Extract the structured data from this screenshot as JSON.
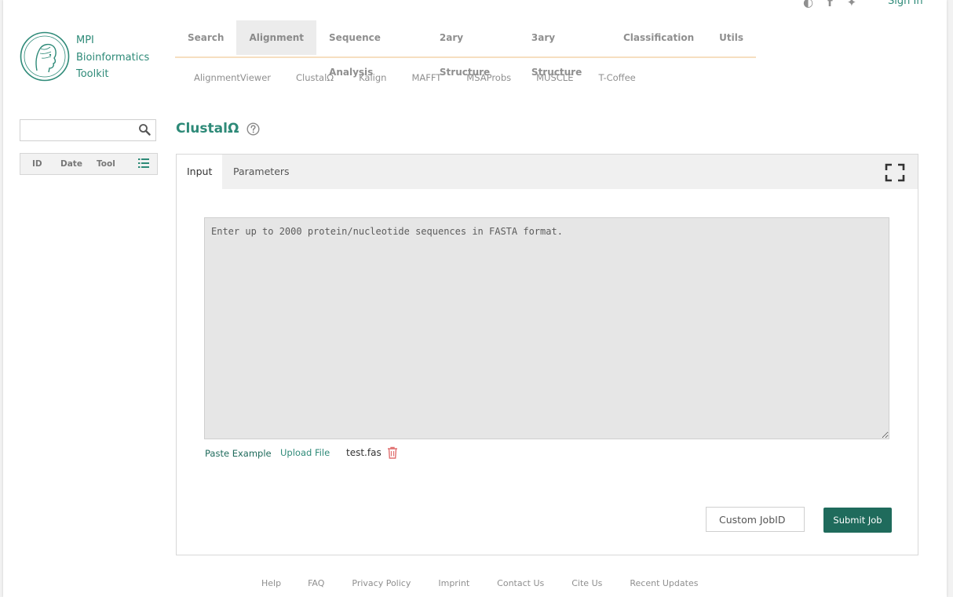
{
  "header": {
    "sign_in": "Sign In",
    "social_icons": [
      "globe-icon",
      "facebook-icon",
      "twitter-icon"
    ]
  },
  "logo": {
    "line1": "MPI",
    "line2": "Bioinformatics",
    "line3": "Toolkit"
  },
  "main_nav": {
    "items": [
      "Search",
      "Alignment",
      "Sequence Analysis",
      "2ary Structure",
      "3ary Structure",
      "Classification",
      "Utils"
    ],
    "active": "Alignment"
  },
  "sub_nav": {
    "items": [
      "AlignmentViewer",
      "ClustalΩ",
      "Kalign",
      "MAFFT",
      "MSAProbs",
      "MUSCLE",
      "T-Coffee"
    ]
  },
  "sidebar": {
    "search_value": "",
    "sort": {
      "id": "ID",
      "date": "Date",
      "tool": "Tool"
    }
  },
  "tool": {
    "title": "ClustalΩ"
  },
  "tabs": {
    "input": "Input",
    "parameters": "Parameters",
    "active": "Input"
  },
  "form": {
    "sequence_placeholder": "Enter up to 2000 protein/nucleotide sequences in FASTA format.",
    "sequence_value": "",
    "paste_example": "Paste Example",
    "upload_file": "Upload File",
    "file_name": "test.fas",
    "jobid_placeholder": "Custom JobID",
    "submit": "Submit Job"
  },
  "footer": {
    "help": "Help",
    "faq": "FAQ",
    "privacy": "Privacy Policy",
    "imprint": "Imprint",
    "contact": "Contact Us",
    "cite": "Cite Us",
    "updates": "Recent Updates"
  },
  "colors": {
    "brand": "#2e8a78",
    "brand_dark": "#1f6b5c",
    "nav_underline": "#f6dfc0",
    "trash": "#e07070"
  }
}
